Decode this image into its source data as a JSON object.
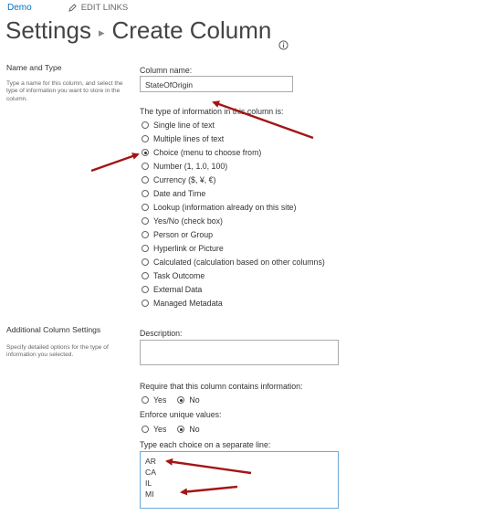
{
  "topbar": {
    "site_link": "Demo",
    "edit_links": "EDIT LINKS"
  },
  "page": {
    "title_root": "Settings",
    "title_page": "Create Column"
  },
  "name_type": {
    "heading": "Name and Type",
    "description": "Type a name for this column, and select the type of information you want to store in the column.",
    "column_name_label": "Column name:",
    "column_name_value": "StateOfOrigin",
    "type_label": "The type of information in this column is:",
    "types": [
      {
        "label": "Single line of text",
        "selected": false
      },
      {
        "label": "Multiple lines of text",
        "selected": false
      },
      {
        "label": "Choice (menu to choose from)",
        "selected": true
      },
      {
        "label": "Number (1, 1.0, 100)",
        "selected": false
      },
      {
        "label": "Currency ($, ¥, €)",
        "selected": false
      },
      {
        "label": "Date and Time",
        "selected": false
      },
      {
        "label": "Lookup (information already on this site)",
        "selected": false
      },
      {
        "label": "Yes/No (check box)",
        "selected": false
      },
      {
        "label": "Person or Group",
        "selected": false
      },
      {
        "label": "Hyperlink or Picture",
        "selected": false
      },
      {
        "label": "Calculated (calculation based on other columns)",
        "selected": false
      },
      {
        "label": "Task Outcome",
        "selected": false
      },
      {
        "label": "External Data",
        "selected": false
      },
      {
        "label": "Managed Metadata",
        "selected": false
      }
    ]
  },
  "additional": {
    "heading": "Additional Column Settings",
    "description": "Specify detailed options for the type of information you selected.",
    "description_label": "Description:",
    "description_value": "",
    "require_label": "Require that this column contains information:",
    "require_yes": "Yes",
    "require_no": "No",
    "require_value": "No",
    "unique_label": "Enforce unique values:",
    "unique_yes": "Yes",
    "unique_no": "No",
    "unique_value": "No",
    "choices_label": "Type each choice on a separate line:",
    "choices": [
      "AR",
      "CA",
      "IL",
      "MI"
    ]
  },
  "colors": {
    "link": "#0072c6",
    "annotation_arrow": "#a31515",
    "focus_border": "#6aa9d8"
  },
  "icons": {
    "edit": "pencil-icon",
    "info": "info-icon",
    "breadcrumb": "chevron-right-icon"
  }
}
